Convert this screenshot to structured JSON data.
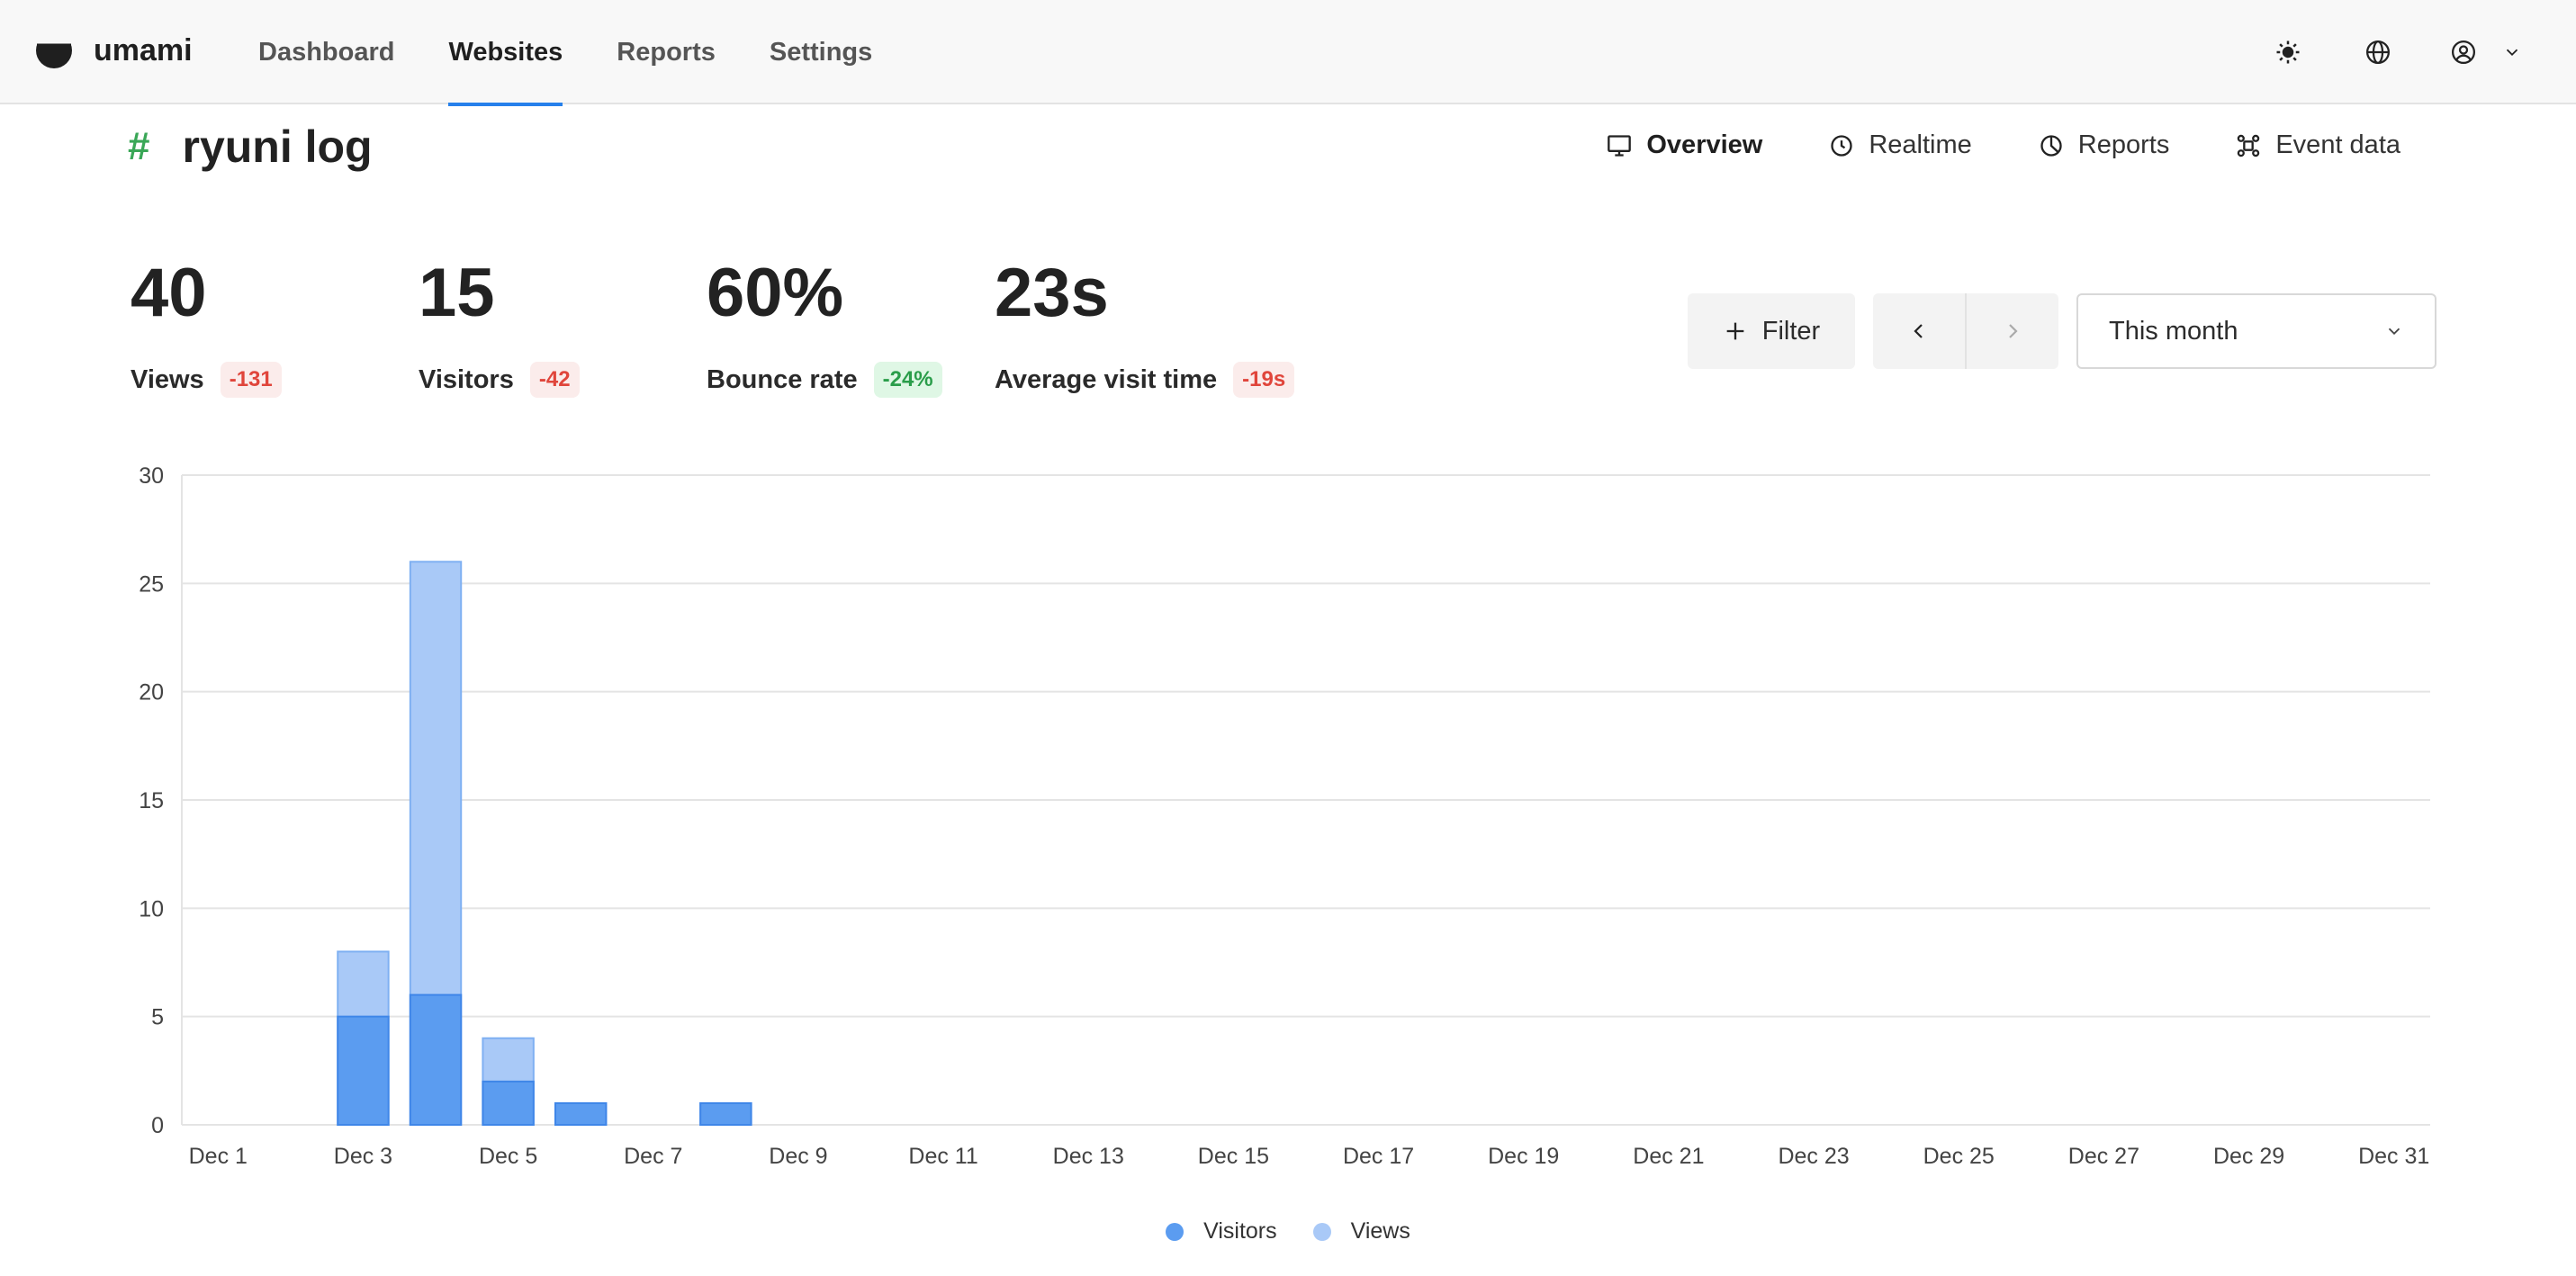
{
  "app": {
    "name": "umami"
  },
  "nav": {
    "items": [
      {
        "label": "Dashboard",
        "active": false
      },
      {
        "label": "Websites",
        "active": true
      },
      {
        "label": "Reports",
        "active": false
      },
      {
        "label": "Settings",
        "active": false
      }
    ]
  },
  "top_icons": [
    "sun-icon",
    "globe-icon",
    "user-profile-icon",
    "chevron-down-icon"
  ],
  "site": {
    "hash": "#",
    "title": "ryuni log",
    "tabs": [
      {
        "label": "Overview",
        "icon": "monitor-icon",
        "active": true
      },
      {
        "label": "Realtime",
        "icon": "clock-icon",
        "active": false
      },
      {
        "label": "Reports",
        "icon": "pie-chart-icon",
        "active": false
      },
      {
        "label": "Event data",
        "icon": "nodes-icon",
        "active": false
      }
    ]
  },
  "metrics": [
    {
      "value": "40",
      "label": "Views",
      "change": "-131",
      "trend": "negative"
    },
    {
      "value": "15",
      "label": "Visitors",
      "change": "-42",
      "trend": "negative"
    },
    {
      "value": "60%",
      "label": "Bounce rate",
      "change": "-24%",
      "trend": "positive"
    },
    {
      "value": "23s",
      "label": "Average visit time",
      "change": "-19s",
      "trend": "negative"
    }
  ],
  "controls": {
    "filter_label": "Filter",
    "date_range": "This month"
  },
  "colors": {
    "accent": "#2680eb",
    "hash": "#3aa757",
    "visitors": "#5b9cf0",
    "views": "#a9c9f7",
    "negative": "#e0453b",
    "positive": "#2a9d4a"
  },
  "chart_data": {
    "type": "bar",
    "stacked_overlay": true,
    "categories": [
      "Dec 1",
      "Dec 2",
      "Dec 3",
      "Dec 4",
      "Dec 5",
      "Dec 6",
      "Dec 7",
      "Dec 8",
      "Dec 9",
      "Dec 10",
      "Dec 11",
      "Dec 12",
      "Dec 13",
      "Dec 14",
      "Dec 15",
      "Dec 16",
      "Dec 17",
      "Dec 18",
      "Dec 19",
      "Dec 20",
      "Dec 21",
      "Dec 22",
      "Dec 23",
      "Dec 24",
      "Dec 25",
      "Dec 26",
      "Dec 27",
      "Dec 28",
      "Dec 29",
      "Dec 30",
      "Dec 31"
    ],
    "tick_labels": [
      "Dec 1",
      "Dec 3",
      "Dec 5",
      "Dec 7",
      "Dec 9",
      "Dec 11",
      "Dec 13",
      "Dec 15",
      "Dec 17",
      "Dec 19",
      "Dec 21",
      "Dec 23",
      "Dec 25",
      "Dec 27",
      "Dec 29",
      "Dec 31"
    ],
    "series": [
      {
        "name": "Visitors",
        "values": [
          0,
          0,
          5,
          6,
          2,
          1,
          0,
          1,
          0,
          0,
          0,
          0,
          0,
          0,
          0,
          0,
          0,
          0,
          0,
          0,
          0,
          0,
          0,
          0,
          0,
          0,
          0,
          0,
          0,
          0,
          0
        ]
      },
      {
        "name": "Views",
        "values": [
          0,
          0,
          8,
          26,
          4,
          1,
          0,
          1,
          0,
          0,
          0,
          0,
          0,
          0,
          0,
          0,
          0,
          0,
          0,
          0,
          0,
          0,
          0,
          0,
          0,
          0,
          0,
          0,
          0,
          0,
          0
        ]
      }
    ],
    "ylim": [
      0,
      30
    ],
    "yticks": [
      0,
      5,
      10,
      15,
      20,
      25,
      30
    ],
    "grid": true,
    "legend": "bottom-center"
  }
}
